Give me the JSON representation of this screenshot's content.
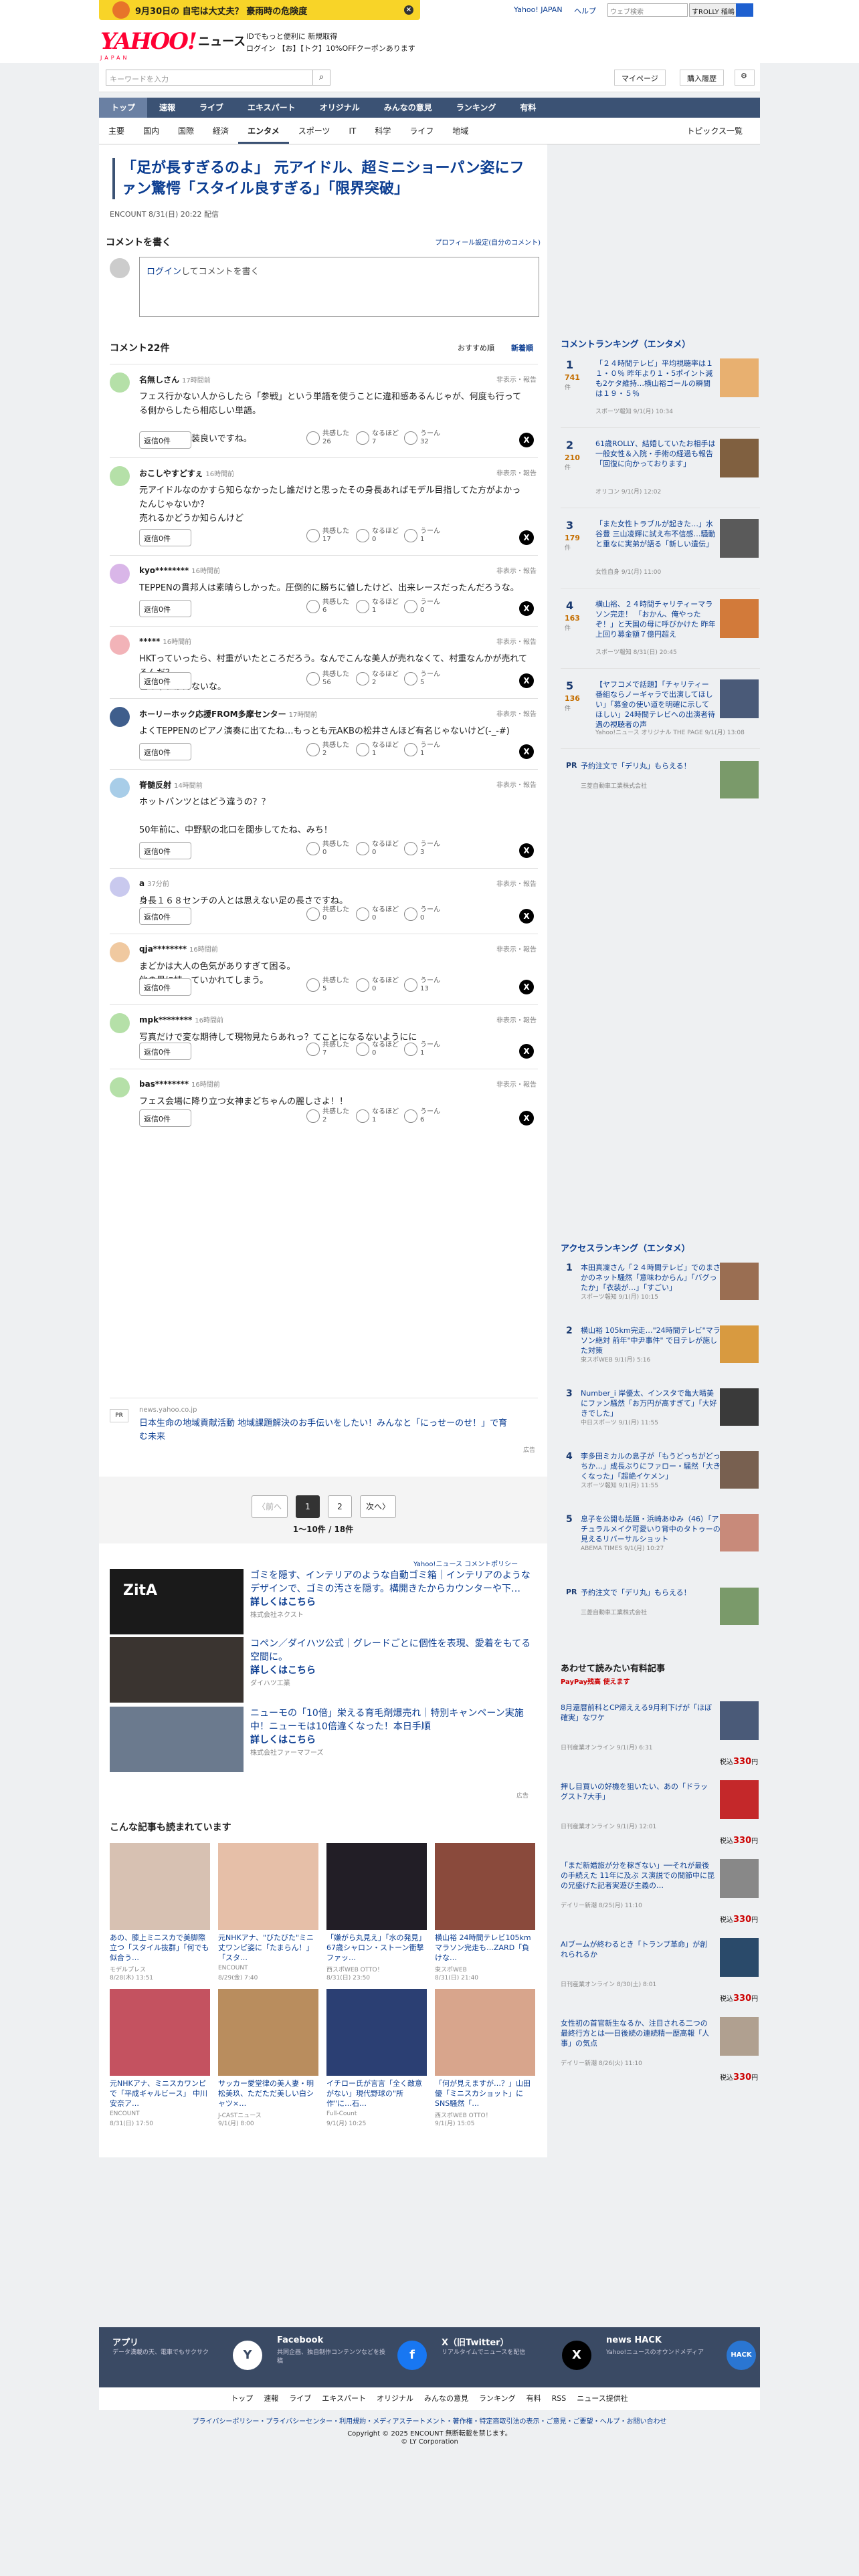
{
  "topbar": {
    "weather": "9月30日の 自宅は大丈夫？ 豪雨時の危険度",
    "yahoo_japan": "Yahoo! JAPAN",
    "help": "ヘルプ",
    "search_placeholder": "ウェブ検索",
    "search_btn": "すROLLY 稲嶋"
  },
  "header": {
    "logo": "YAHOO!",
    "logo_sub": "JAPAN",
    "news": "ニュース",
    "promo1": "IDでもっと便利に 新規取得",
    "promo2": "ログイン 【お】【トク】10%OFFクーポンあります"
  },
  "searchrow": {
    "placeholder": "キーワードを入力",
    "mypage": "マイページ",
    "history": "購入履歴"
  },
  "nav": [
    "トップ",
    "速報",
    "ライブ",
    "エキスパート",
    "オリジナル",
    "みんなの意見",
    "ランキング",
    "有料"
  ],
  "subnav": [
    "主要",
    "国内",
    "国際",
    "経済",
    "エンタメ",
    "スポーツ",
    "IT",
    "科学",
    "ライフ",
    "地域"
  ],
  "subnav_right": "トピックス一覧",
  "article": {
    "title": "「足が長すぎるのよ」 元アイドル、超ミニショーパン姿にファン驚愕「スタイル良すぎる」「限界突破」",
    "meta": "ENCOUNT 8/31(日) 20:22 配信"
  },
  "write": {
    "heading": "コメントを書く",
    "profile": "プロフィール設定(自分のコメント)",
    "login": "ログイン",
    "placeholder": "してコメントを書く"
  },
  "comments_head": {
    "title": "コメント22件",
    "sort1": "おすすめ順",
    "sort2": "新着順"
  },
  "labels": {
    "reply": "返信0件",
    "hide": "非表示・報告",
    "r1": "共感した",
    "r2": "なるほど",
    "r3": "うーん"
  },
  "comments": [
    {
      "name": "名無しさん",
      "ago": "17時間前",
      "body": "フェス行かない人からしたら「参戦」という単語を使うことに違和感あるんじゃが、何度も行ってる側からしたら相応しい単語。\n\nあ、このお衣装良いですね。",
      "r1": "26",
      "r2": "7",
      "r3": "32"
    },
    {
      "name": "おこしやすどすぇ",
      "ago": "16時間前",
      "body": "元アイドルなのかすら知らなかったし誰だけと思ったその身長あればモデル目指してた方がよかったんじゃないか？\n売れるかどうか知らんけど",
      "r1": "17",
      "r2": "0",
      "r3": "1"
    },
    {
      "name": "kyo********",
      "ago": "16時間前",
      "body": "TEPPENの貫邦人は素晴らしかった。圧倒的に勝ちに値したけど、出来レースだったんだろうな。",
      "r1": "6",
      "r2": "1",
      "r3": "0"
    },
    {
      "name": "*****",
      "ago": "16時間前",
      "body": "HKTっていったら、村重がいたところだろう。なんでこんな美人が売れなくて、村重なんかが売れてるんだ？\n世の中わかんないな。",
      "r1": "56",
      "r2": "2",
      "r3": "5"
    },
    {
      "name": "ホーリーホック応援FROM多摩センター",
      "ago": "17時間前",
      "body": "よくTEPPENのピアノ演奏に出てたね…もっとも元AKBの松井さんほど有名じゃないけど(-_-#)",
      "r1": "2",
      "r2": "1",
      "r3": "1"
    },
    {
      "name": "脊髄反射",
      "ago": "14時間前",
      "body": "ホットパンツとはどう違うの？？\n\n50年前に、中野駅の北口を闊歩してたね、みち！\n\n・",
      "r1": "0",
      "r2": "0",
      "r3": "3"
    },
    {
      "name": "a",
      "ago": "37分前",
      "body": "身長１６８センチの人とは思えない足の長さですね。",
      "r1": "0",
      "r2": "0",
      "r3": "0"
    },
    {
      "name": "qja********",
      "ago": "16時間前",
      "body": "まどかは大人の色気がありすぎて困る。\n他の男に持っていかれてしまう。",
      "r1": "5",
      "r2": "0",
      "r3": "13"
    },
    {
      "name": "mpk********",
      "ago": "16時間前",
      "body": "写真だけで変な期待して現物見たらあれっ？てことになるないようにに",
      "r1": "7",
      "r2": "0",
      "r3": "1"
    },
    {
      "name": "bas********",
      "ago": "16時間前",
      "body": "フェス会場に降り立つ女神まどちゃんの麗しさよ！！",
      "r1": "2",
      "r2": "1",
      "r3": "6"
    }
  ],
  "cmt_ad": {
    "domain": "news.yahoo.co.jp",
    "text": "日本生命の地域貢献活動 地域課題解決のお手伝いをしたい！みんなと「にっせーのせ！」で育む未来",
    "pr": "広告"
  },
  "pager": {
    "prev": "〈前へ",
    "p1": "1",
    "p2": "2",
    "next": "次へ〉",
    "count": "1〜10件 / 18件"
  },
  "policy": "Yahoo!ニュース コメントポリシー",
  "ads": [
    {
      "title": "ゴミを隠す、インテリアのような自動ゴミ箱｜インテリアのようなデザインで、ゴミの汚さを隠す。構開きたからカウンターや下…",
      "more": "詳しくはこちら",
      "sponsor": "株式会社ネクスト　",
      "label": "ZitA",
      "c": "#1a1a1a"
    },
    {
      "title": "コペン／ダイハツ公式｜グレードごとに個性を表現、愛着をもてる空間に。",
      "more": "詳しくはこちら",
      "sponsor": "ダイハツ工業",
      "label": "",
      "c": "#3a3430"
    },
    {
      "title": "ニューモの「10倍」栄える育毛剤爆売れ｜特別キャンペーン実施中！ニューモは10倍違くなった！本日手順",
      "more": "詳しくはこちら",
      "sponsor": "株式会社ファーマフーズ",
      "label": "",
      "c": "#6b7a8e"
    }
  ],
  "ads_pr": "広告",
  "read_head": "こんな記事も読まれています",
  "cards": [
    {
      "title": "あの、膝上ミニスカで美脚際立つ「スタイル抜群」「何でも似合う…",
      "src": "モデルプレス",
      "dt": "8/28(木) 13:51",
      "c": "#d7c1b2"
    },
    {
      "title": "元NHKアナ、\"びたびた\"ミニ丈ワンピ姿に「たまらん！」「スタ…",
      "src": "ENCOUNT",
      "dt": "8/29(金) 7:40",
      "c": "#e6bfa8"
    },
    {
      "title": "「嫌がら丸見え」「水の発見」67歳シャロン・ストーン衝撃ファッ…",
      "src": "西スポWEB OTTO！",
      "dt": "8/31(日) 23:50",
      "c": "#221e26"
    },
    {
      "title": "横山裕 24時間テレビ105kmマラソン完走も…ZARD「負けな…",
      "src": "東スポWEB",
      "dt": "8/31(日) 21:40",
      "c": "#8a4a3c"
    },
    {
      "title": "元NHKアナ、ミニスカワンピで「平成ギャルビース」 中川安奈ア…",
      "src": "ENCOUNT",
      "dt": "8/31(日) 17:50",
      "c": "#c45260"
    },
    {
      "title": "サッカー愛堂律の美人妻・明松美玖、ただただ美しい白シャツ×…",
      "src": "J-CASTニュース",
      "dt": "9/1(月) 8:00",
      "c": "#b98d5e"
    },
    {
      "title": "イチロー氏が言言「全く敵意がない」現代野球の\"所作\"に…石…",
      "src": "Full-Count",
      "dt": "9/1(月) 10:25",
      "c": "#2b3f73"
    },
    {
      "title": "「何が見えますが…？」山田優「ミニスカショット」にSNS騒然「…",
      "src": "西スポWEB OTTO！",
      "dt": "9/1(月) 15:05",
      "c": "#d8a58c"
    }
  ],
  "side": {
    "rank_head": "コメントランキング（エンタメ）",
    "ranks": [
      {
        "no": "1",
        "cnt": "741",
        "title": "「２４時間テレビ」平均視聴率は１１・０％ 昨年より１・5ポイント減も2ケタ維持…横山裕ゴールの瞬間は１９・５％",
        "src": "スポーツ報知 9/1(月) 10:34",
        "c": "#e8b070"
      },
      {
        "no": "2",
        "cnt": "210",
        "title": "61歳ROLLY、結婚していたお相手は一般女性＆入院・手術の経過も報告「回復に向かっております」",
        "src": "オリコン 9/1(月) 12:02",
        "c": "#806040"
      },
      {
        "no": "3",
        "cnt": "179",
        "title": "「また女性トラブルが起きた…」水谷豊 三山凌輝に試え布不信感…騒動と重なに実弟が語る「新しい遺伝」",
        "src": "女性自身 9/1(月) 11:00",
        "c": "#5a5a5a"
      },
      {
        "no": "4",
        "cnt": "163",
        "title": "横山裕、２４時間チャリティーマラソン完走！ 「おかん、俺やったぞ！」と天国の母に呼びかけた 昨年上回り募金額７億円超え",
        "src": "スポーツ報知 8/31(日) 20:45",
        "c": "#d27a3a"
      },
      {
        "no": "5",
        "cnt": "136",
        "title": "【ヤフコメで話題】「チャリティー番組ならノーギャラで出演してほしい」「募金の使い道を明確に示してほしい」24時間テレビへの出演者待遇の視聴者の声",
        "src": "Yahoo!ニュース オリジナル THE PAGE 9/1(月) 13:08",
        "c": "#4a5a78"
      }
    ],
    "rank_ad": {
      "title": "予約注文で「デリ丸」もらえる！",
      "src": "三菱自動車工業株式会社"
    },
    "access_head": "アクセスランキング（エンタメ）",
    "access": [
      {
        "no": "1",
        "title": "本田真凜さん「２４時間テレビ」でのまさかのネット騒然「意味わからん」「バグったか」「衣装が…」「すごい」",
        "src": "スポーツ報知 9/1(月) 10:15",
        "c": "#9a6e52"
      },
      {
        "no": "2",
        "title": "横山裕 105km完走…\"24時間テレビ\"マラソン絶対 前年\"中尹事件\" で日テレが施した対策",
        "src": "東スポWEB 9/1(月) 5:16",
        "c": "#d89a40"
      },
      {
        "no": "3",
        "title": "Number_i 岸優太、インスタで亀大晴美にファン騒然「お万円が高すぎて」「大好きでした」",
        "src": "中日スポーツ 9/1(月) 11:55",
        "c": "#3a3a3a"
      },
      {
        "no": "4",
        "title": "李多田ミカルの息子が「もうどっちがどっちか…」成長ぶりにファロー・騒然「大きくなった」「超絶イケメン」",
        "src": "スポーツ報知 9/1(月) 11:55",
        "c": "#786050"
      },
      {
        "no": "5",
        "title": "息子を公開も話題・浜崎あゆみ（46）「アチュラルメイク可愛いり背中のタトゥーの見えるリバーサルショット",
        "src": "ABEMA TIMES 9/1(月) 10:27",
        "c": "#c88a7a"
      }
    ],
    "access_ad": {
      "title": "予約注文で「デリ丸」もらえる！",
      "src": "三菱自動車工業株式会社"
    },
    "book_head": "あわせて読みたい有料記事",
    "paypay": "PayPay残高 使えます",
    "books": [
      {
        "title": "8月還暦前科とCP帰ええる9月利下げが「ほぼ確実」なワケ",
        "src": "日刊産業オンライン 9/1(月) 6:31",
        "price": "330",
        "c": "#4a5a78"
      },
      {
        "title": "押し目買いの好機を狙いたい、あの「ドラッグスト7大手」",
        "src": "日刊産業オンライン 9/1(月) 12:01",
        "price": "330",
        "c": "#c4282a"
      },
      {
        "title": "「まだ新婚旅が分を稼ぎない」──それが最後の手続えた 11年に及ぶ ス演説での間節中に昆の兄盛げた記者実遊び主義の…",
        "src": "デイリー新潮 8/25(月) 11:10",
        "price": "330",
        "c": "#888"
      },
      {
        "title": "AIブームが終わるとき「トランプ革命」が創れられるか",
        "src": "日刊産業オンライン 8/30(土) 8:01",
        "price": "330",
        "c": "#2a4a6a"
      },
      {
        "title": "女性初の首官新生なるか、注目される二つの最終行方とは──日後続の連続精一歴高報「人事」の気点",
        "src": "デイリー新潮 8/26(火) 11:10",
        "price": "330",
        "c": "#b0a090"
      }
    ],
    "yen": "税込"
  },
  "footer_apps": [
    {
      "name": "アプリ",
      "desc": "データ満載の天、電車でもサクサク",
      "icon": "Y"
    },
    {
      "name": "Facebook",
      "desc": "共同企画、独自制作コンテンツなどを投稿",
      "icon": "f"
    },
    {
      "name": "X（旧Twitter）",
      "desc": "リアルタイムでニュースを配信",
      "icon": "X"
    },
    {
      "name": "news HACK",
      "desc": "Yahoo!ニュースのオウンドメディア",
      "icon": "HACK"
    }
  ],
  "footer_nav": [
    "トップ",
    "速報",
    "ライブ",
    "エキスパート",
    "オリジナル",
    "みんなの意見",
    "ランキング",
    "有料",
    "RSS",
    "ニュース提供社"
  ],
  "footer_links": "プライバシーポリシー・プライバシーセンター・利用規約・メディアステートメント・著作権・特定商取引法の表示・ご意見・ご要望・ヘルプ・お問い合わせ",
  "copy1": "Copyright © 2025 ENCOUNT 無断転載を禁じます。",
  "copy2": "© LY Corporation"
}
